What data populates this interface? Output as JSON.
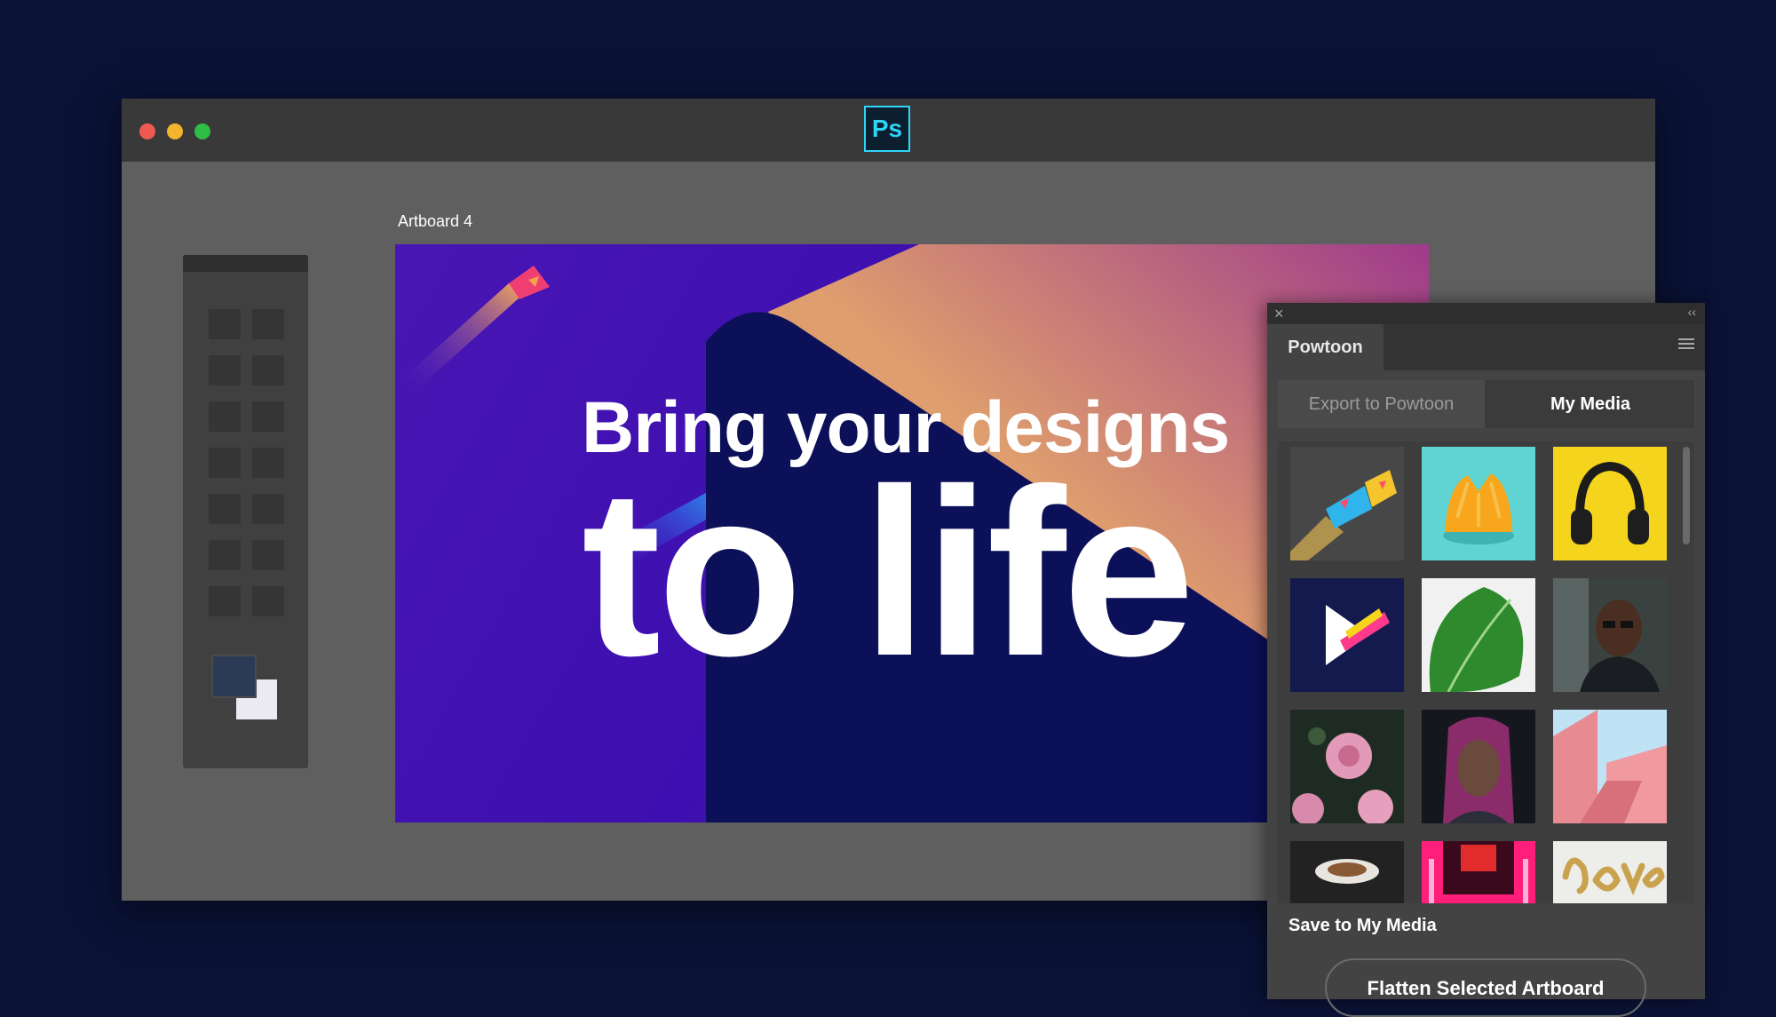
{
  "app": {
    "logo_text": "Ps",
    "brand_color": "#2fd4f7",
    "window_controls": [
      "close",
      "minimize",
      "maximize"
    ]
  },
  "artboard": {
    "label": "Artboard 4",
    "headline_line1": "Bring your designs",
    "headline_line2": "to life"
  },
  "panel": {
    "tab_label": "Powtoon",
    "close_icon": "×",
    "collapse_icon": "‹‹",
    "segments": {
      "export_label": "Export to Powtoon",
      "mymedia_label": "My Media",
      "active": "My Media"
    },
    "media_items": [
      "powtoon-pencil-thumbnail",
      "orange-thumbnail",
      "headphones-thumbnail",
      "powtoon-logo-thumbnail",
      "leaf-thumbnail",
      "man-with-glasses-thumbnail",
      "flowers-thumbnail",
      "woman-portrait-thumbnail",
      "pink-building-thumbnail",
      "coffee-thumbnail",
      "neon-sign-thumbnail",
      "love-balloon-thumbnail"
    ],
    "save_label": "Save to My Media",
    "flatten_label": "Flatten Selected Artboard"
  }
}
